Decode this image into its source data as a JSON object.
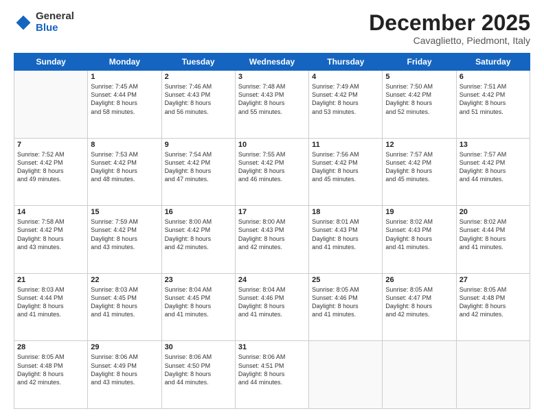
{
  "logo": {
    "general": "General",
    "blue": "Blue"
  },
  "header": {
    "month": "December 2025",
    "location": "Cavaglietto, Piedmont, Italy"
  },
  "days_of_week": [
    "Sunday",
    "Monday",
    "Tuesday",
    "Wednesday",
    "Thursday",
    "Friday",
    "Saturday"
  ],
  "weeks": [
    [
      {
        "day": "",
        "info": ""
      },
      {
        "day": "1",
        "info": "Sunrise: 7:45 AM\nSunset: 4:44 PM\nDaylight: 8 hours\nand 58 minutes."
      },
      {
        "day": "2",
        "info": "Sunrise: 7:46 AM\nSunset: 4:43 PM\nDaylight: 8 hours\nand 56 minutes."
      },
      {
        "day": "3",
        "info": "Sunrise: 7:48 AM\nSunset: 4:43 PM\nDaylight: 8 hours\nand 55 minutes."
      },
      {
        "day": "4",
        "info": "Sunrise: 7:49 AM\nSunset: 4:42 PM\nDaylight: 8 hours\nand 53 minutes."
      },
      {
        "day": "5",
        "info": "Sunrise: 7:50 AM\nSunset: 4:42 PM\nDaylight: 8 hours\nand 52 minutes."
      },
      {
        "day": "6",
        "info": "Sunrise: 7:51 AM\nSunset: 4:42 PM\nDaylight: 8 hours\nand 51 minutes."
      }
    ],
    [
      {
        "day": "7",
        "info": "Sunrise: 7:52 AM\nSunset: 4:42 PM\nDaylight: 8 hours\nand 49 minutes."
      },
      {
        "day": "8",
        "info": "Sunrise: 7:53 AM\nSunset: 4:42 PM\nDaylight: 8 hours\nand 48 minutes."
      },
      {
        "day": "9",
        "info": "Sunrise: 7:54 AM\nSunset: 4:42 PM\nDaylight: 8 hours\nand 47 minutes."
      },
      {
        "day": "10",
        "info": "Sunrise: 7:55 AM\nSunset: 4:42 PM\nDaylight: 8 hours\nand 46 minutes."
      },
      {
        "day": "11",
        "info": "Sunrise: 7:56 AM\nSunset: 4:42 PM\nDaylight: 8 hours\nand 45 minutes."
      },
      {
        "day": "12",
        "info": "Sunrise: 7:57 AM\nSunset: 4:42 PM\nDaylight: 8 hours\nand 45 minutes."
      },
      {
        "day": "13",
        "info": "Sunrise: 7:57 AM\nSunset: 4:42 PM\nDaylight: 8 hours\nand 44 minutes."
      }
    ],
    [
      {
        "day": "14",
        "info": "Sunrise: 7:58 AM\nSunset: 4:42 PM\nDaylight: 8 hours\nand 43 minutes."
      },
      {
        "day": "15",
        "info": "Sunrise: 7:59 AM\nSunset: 4:42 PM\nDaylight: 8 hours\nand 43 minutes."
      },
      {
        "day": "16",
        "info": "Sunrise: 8:00 AM\nSunset: 4:42 PM\nDaylight: 8 hours\nand 42 minutes."
      },
      {
        "day": "17",
        "info": "Sunrise: 8:00 AM\nSunset: 4:43 PM\nDaylight: 8 hours\nand 42 minutes."
      },
      {
        "day": "18",
        "info": "Sunrise: 8:01 AM\nSunset: 4:43 PM\nDaylight: 8 hours\nand 41 minutes."
      },
      {
        "day": "19",
        "info": "Sunrise: 8:02 AM\nSunset: 4:43 PM\nDaylight: 8 hours\nand 41 minutes."
      },
      {
        "day": "20",
        "info": "Sunrise: 8:02 AM\nSunset: 4:44 PM\nDaylight: 8 hours\nand 41 minutes."
      }
    ],
    [
      {
        "day": "21",
        "info": "Sunrise: 8:03 AM\nSunset: 4:44 PM\nDaylight: 8 hours\nand 41 minutes."
      },
      {
        "day": "22",
        "info": "Sunrise: 8:03 AM\nSunset: 4:45 PM\nDaylight: 8 hours\nand 41 minutes."
      },
      {
        "day": "23",
        "info": "Sunrise: 8:04 AM\nSunset: 4:45 PM\nDaylight: 8 hours\nand 41 minutes."
      },
      {
        "day": "24",
        "info": "Sunrise: 8:04 AM\nSunset: 4:46 PM\nDaylight: 8 hours\nand 41 minutes."
      },
      {
        "day": "25",
        "info": "Sunrise: 8:05 AM\nSunset: 4:46 PM\nDaylight: 8 hours\nand 41 minutes."
      },
      {
        "day": "26",
        "info": "Sunrise: 8:05 AM\nSunset: 4:47 PM\nDaylight: 8 hours\nand 42 minutes."
      },
      {
        "day": "27",
        "info": "Sunrise: 8:05 AM\nSunset: 4:48 PM\nDaylight: 8 hours\nand 42 minutes."
      }
    ],
    [
      {
        "day": "28",
        "info": "Sunrise: 8:05 AM\nSunset: 4:48 PM\nDaylight: 8 hours\nand 42 minutes."
      },
      {
        "day": "29",
        "info": "Sunrise: 8:06 AM\nSunset: 4:49 PM\nDaylight: 8 hours\nand 43 minutes."
      },
      {
        "day": "30",
        "info": "Sunrise: 8:06 AM\nSunset: 4:50 PM\nDaylight: 8 hours\nand 44 minutes."
      },
      {
        "day": "31",
        "info": "Sunrise: 8:06 AM\nSunset: 4:51 PM\nDaylight: 8 hours\nand 44 minutes."
      },
      {
        "day": "",
        "info": ""
      },
      {
        "day": "",
        "info": ""
      },
      {
        "day": "",
        "info": ""
      }
    ]
  ]
}
